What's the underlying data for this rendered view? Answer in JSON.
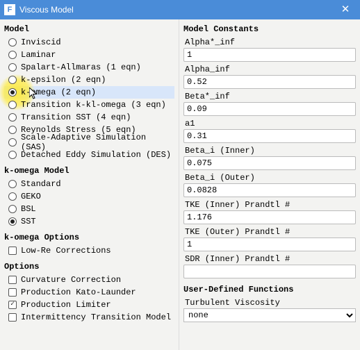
{
  "titlebar": {
    "icon_letter": "F",
    "title": "Viscous Model",
    "close": "✕"
  },
  "model": {
    "heading": "Model",
    "items": [
      {
        "label": "Inviscid",
        "selected": false
      },
      {
        "label": "Laminar",
        "selected": false
      },
      {
        "label": "Spalart-Allmaras (1 eqn)",
        "selected": false
      },
      {
        "label": "k-epsilon (2 eqn)",
        "selected": false
      },
      {
        "label": "k-omega (2 eqn)",
        "selected": true,
        "hovered": true,
        "highlight": true
      },
      {
        "label": "Transition k-kl-omega (3 eqn)",
        "selected": false
      },
      {
        "label": "Transition SST (4 eqn)",
        "selected": false
      },
      {
        "label": "Reynolds Stress (5 eqn)",
        "selected": false
      },
      {
        "label": "Scale-Adaptive Simulation (SAS)",
        "selected": false
      },
      {
        "label": "Detached Eddy Simulation (DES)",
        "selected": false
      }
    ]
  },
  "komega_model": {
    "heading": "k-omega Model",
    "items": [
      {
        "label": "Standard",
        "selected": false
      },
      {
        "label": "GEKO",
        "selected": false
      },
      {
        "label": "BSL",
        "selected": false
      },
      {
        "label": "SST",
        "selected": true
      }
    ]
  },
  "komega_options": {
    "heading": "k-omega Options",
    "items": [
      {
        "label": "Low-Re Corrections",
        "checked": false
      }
    ]
  },
  "options": {
    "heading": "Options",
    "items": [
      {
        "label": "Curvature Correction",
        "checked": false
      },
      {
        "label": "Production Kato-Launder",
        "checked": false
      },
      {
        "label": "Production Limiter",
        "checked": true
      },
      {
        "label": "Intermittency Transition Model",
        "checked": false
      }
    ]
  },
  "constants": {
    "heading": "Model Constants",
    "items": [
      {
        "label": "Alpha*_inf",
        "value": "1"
      },
      {
        "label": "Alpha_inf",
        "value": "0.52"
      },
      {
        "label": "Beta*_inf",
        "value": "0.09"
      },
      {
        "label": "a1",
        "value": "0.31"
      },
      {
        "label": "Beta_i (Inner)",
        "value": "0.075"
      },
      {
        "label": "Beta_i (Outer)",
        "value": "0.0828"
      },
      {
        "label": "TKE (Inner) Prandtl #",
        "value": "1.176"
      },
      {
        "label": "TKE (Outer) Prandtl #",
        "value": "1"
      },
      {
        "label": "SDR (Inner) Prandtl #",
        "value": ""
      }
    ]
  },
  "udf": {
    "heading": "User-Defined Functions",
    "turb_visc_label": "Turbulent Viscosity",
    "turb_visc_value": "none"
  }
}
